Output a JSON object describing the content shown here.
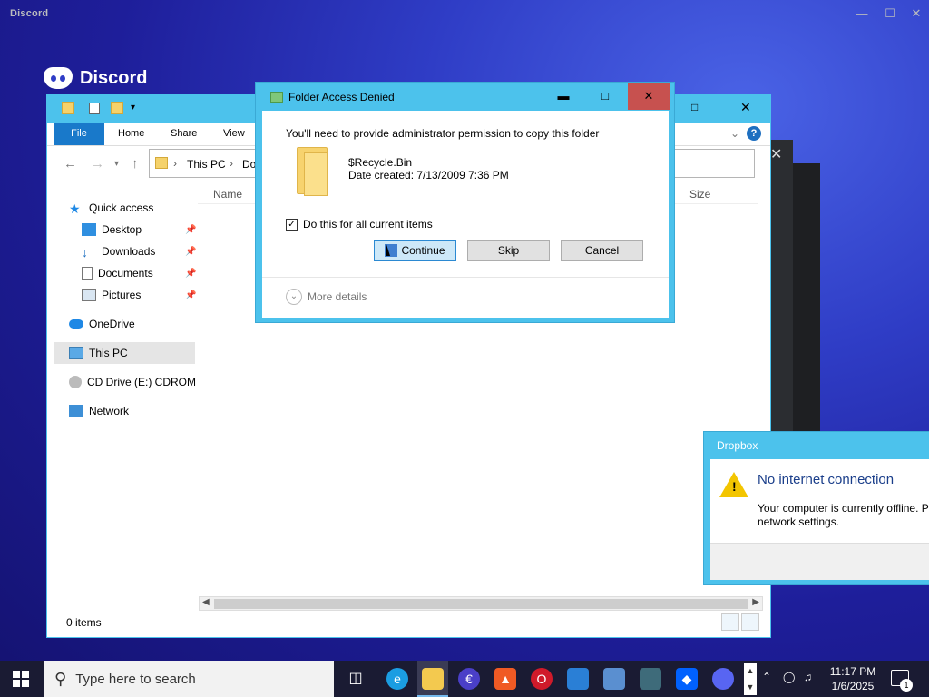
{
  "discord": {
    "window_title": "Discord",
    "brand": "Discord"
  },
  "explorer": {
    "tabs": [
      "File",
      "Home",
      "Share",
      "View"
    ],
    "breadcrumb": [
      "This PC",
      "Do"
    ],
    "columns": {
      "name": "Name",
      "size": "Size"
    },
    "nav": {
      "quick_access": "Quick access",
      "desktop": "Desktop",
      "downloads": "Downloads",
      "documents": "Documents",
      "pictures": "Pictures",
      "onedrive": "OneDrive",
      "this_pc": "This PC",
      "cd_drive": "CD Drive (E:) CDROM",
      "network": "Network"
    },
    "status": "0 items"
  },
  "dialog": {
    "title": "Folder Access Denied",
    "message": "You'll need to provide administrator permission to copy this folder",
    "folder_name": "$Recycle.Bin",
    "date_created": "Date created: 7/13/2009 7:36 PM",
    "checkbox_label": "Do this for all current items",
    "checkbox_checked": true,
    "buttons": {
      "continue": "Continue",
      "skip": "Skip",
      "cancel": "Cancel"
    },
    "more_details": "More details"
  },
  "dropbox": {
    "title": "Dropbox",
    "heading": "No internet connection",
    "line1": "Your computer is currently offline. P",
    "line2": "network settings."
  },
  "taskbar": {
    "search_placeholder": "Type here to search",
    "time": "11:17 PM",
    "date": "1/6/2025",
    "notification_count": "1"
  },
  "colors": {
    "accent": "#4cc2ec",
    "file_tab": "#1979ca",
    "dialog_close": "#c7514f",
    "taskbar": "#1a1b33"
  }
}
